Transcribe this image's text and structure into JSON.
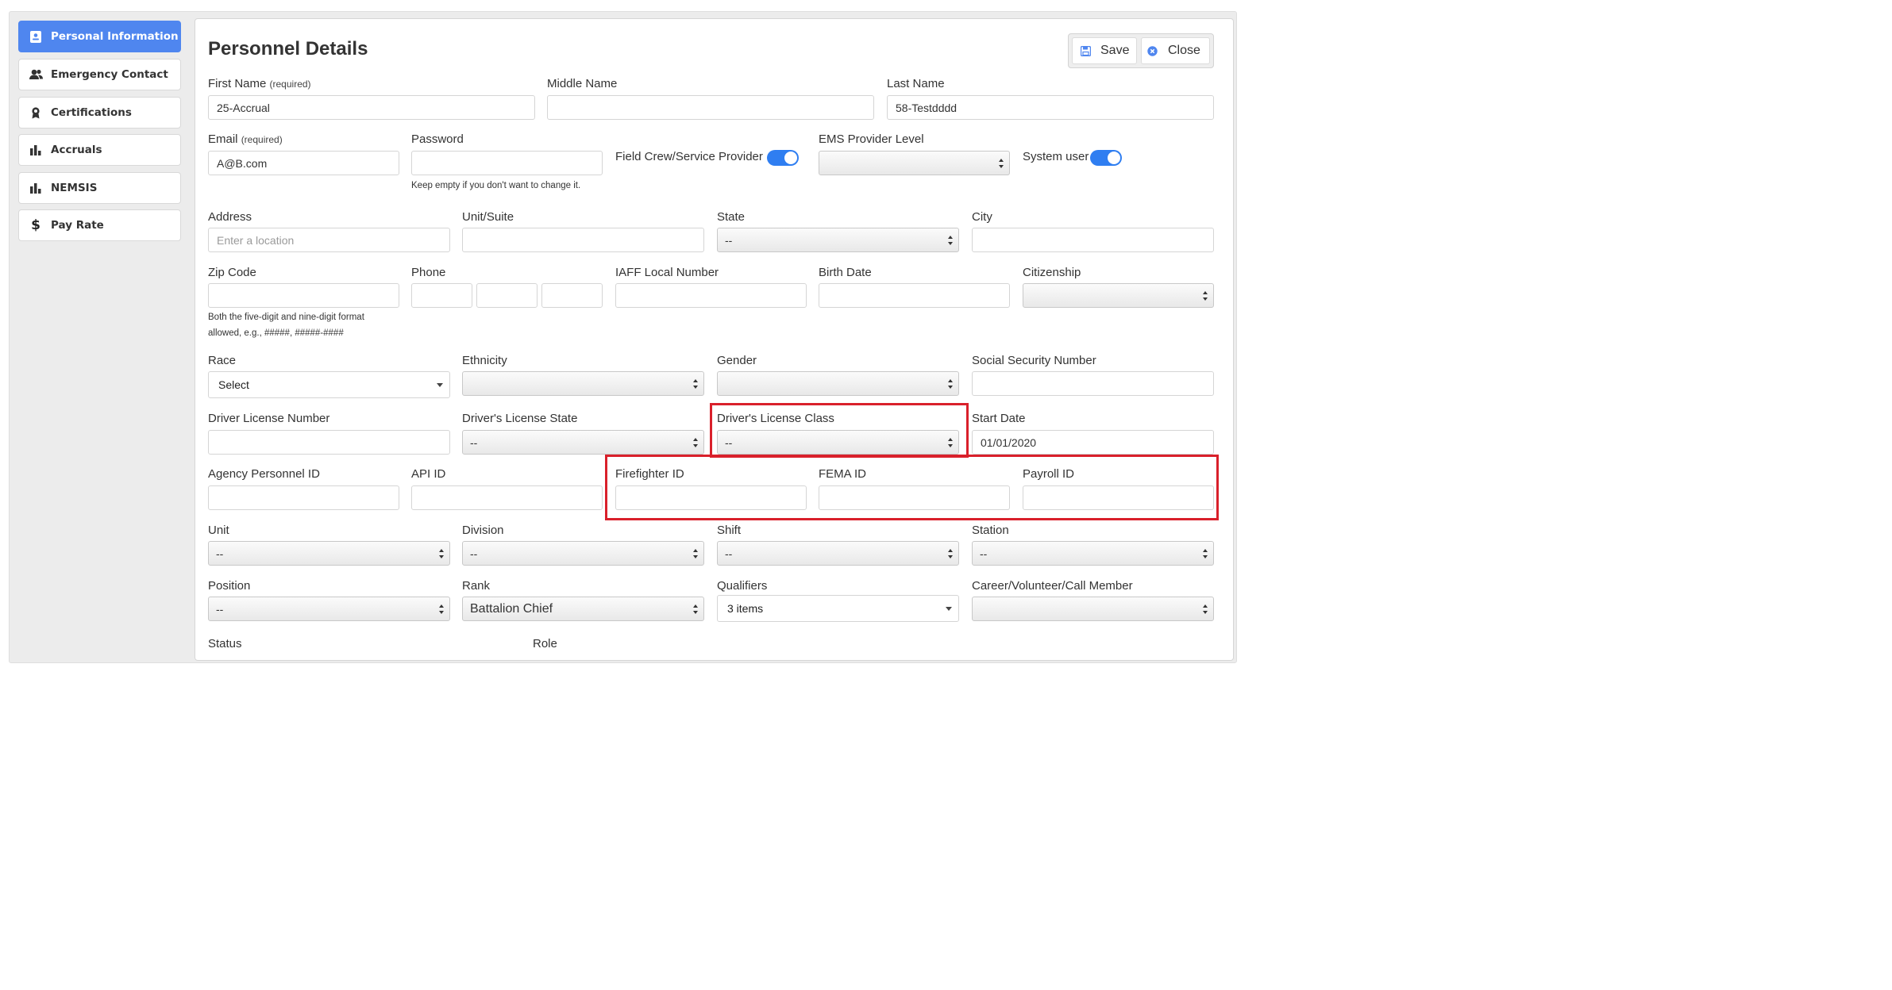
{
  "sidebar": {
    "items": [
      {
        "label": "Personal Information",
        "icon": "id-card-icon",
        "active": true
      },
      {
        "label": "Emergency Contact",
        "icon": "users-icon"
      },
      {
        "label": "Certifications",
        "icon": "award-icon"
      },
      {
        "label": "Accruals",
        "icon": "bar-chart-icon"
      },
      {
        "label": "NEMSIS",
        "icon": "bar-chart-icon"
      },
      {
        "label": "Pay Rate",
        "icon": "dollar-icon"
      }
    ]
  },
  "header": {
    "title": "Personnel Details",
    "save_label": "Save",
    "close_label": "Close"
  },
  "form": {
    "first_name": {
      "label": "First Name",
      "note": "(required)",
      "value": "25-Accrual"
    },
    "middle_name": {
      "label": "Middle Name",
      "value": ""
    },
    "last_name": {
      "label": "Last Name",
      "value": "58-Testdddd"
    },
    "email": {
      "label": "Email",
      "note": "(required)",
      "value": "A@B.com"
    },
    "password": {
      "label": "Password",
      "value": "",
      "help": "Keep empty if you don't want to change it."
    },
    "field_crew": {
      "label": "Field Crew/Service Provider",
      "on": true
    },
    "ems_level": {
      "label": "EMS Provider Level",
      "value": ""
    },
    "system_user": {
      "label": "System user",
      "on": true
    },
    "address": {
      "label": "Address",
      "placeholder": "Enter a location"
    },
    "unit_suite": {
      "label": "Unit/Suite",
      "value": ""
    },
    "state": {
      "label": "State",
      "value": "--"
    },
    "city": {
      "label": "City",
      "value": ""
    },
    "zip": {
      "label": "Zip Code",
      "value": "",
      "help1": "Both the five-digit and nine-digit format",
      "help2": "allowed, e.g., #####, #####-####"
    },
    "phone": {
      "label": "Phone"
    },
    "iaff": {
      "label": "IAFF Local Number",
      "value": ""
    },
    "birth_date": {
      "label": "Birth Date",
      "value": ""
    },
    "citizenship": {
      "label": "Citizenship",
      "value": ""
    },
    "race": {
      "label": "Race",
      "value": "Select"
    },
    "ethnicity": {
      "label": "Ethnicity",
      "value": ""
    },
    "gender": {
      "label": "Gender",
      "value": ""
    },
    "ssn": {
      "label": "Social Security Number",
      "value": ""
    },
    "dl_number": {
      "label": "Driver License Number",
      "value": ""
    },
    "dl_state": {
      "label": "Driver's License State",
      "value": "--"
    },
    "dl_class": {
      "label": "Driver's License Class",
      "value": "--"
    },
    "start_date": {
      "label": "Start Date",
      "value": "01/01/2020"
    },
    "agency_id": {
      "label": "Agency Personnel ID",
      "value": ""
    },
    "api_id": {
      "label": "API ID",
      "value": ""
    },
    "firefighter_id": {
      "label": "Firefighter ID",
      "value": ""
    },
    "fema_id": {
      "label": "FEMA ID",
      "value": ""
    },
    "payroll_id": {
      "label": "Payroll ID",
      "value": ""
    },
    "unit": {
      "label": "Unit",
      "value": "--"
    },
    "division": {
      "label": "Division",
      "value": "--"
    },
    "shift": {
      "label": "Shift",
      "value": "--"
    },
    "station": {
      "label": "Station",
      "value": "--"
    },
    "position": {
      "label": "Position",
      "value": "--"
    },
    "rank": {
      "label": "Rank",
      "value": "Battalion Chief"
    },
    "qualifiers": {
      "label": "Qualifiers",
      "value": "3 items"
    },
    "career": {
      "label": "Career/Volunteer/Call Member",
      "value": ""
    },
    "status": {
      "label": "Status"
    },
    "role": {
      "label": "Role"
    }
  },
  "colors": {
    "accent": "#4f86ef",
    "toggle": "#2f7ef1",
    "highlight": "#d9202b"
  }
}
